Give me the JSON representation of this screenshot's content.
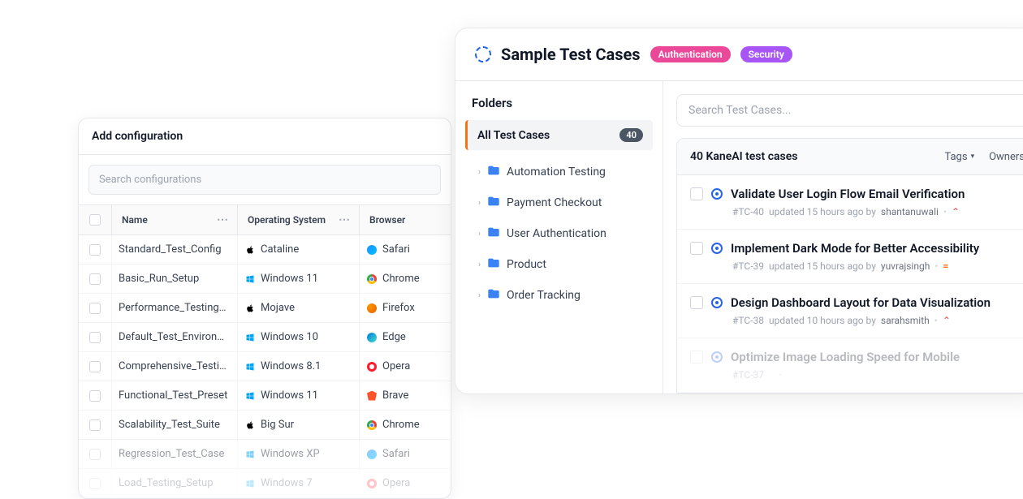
{
  "config": {
    "title": "Add configuration",
    "search_placeholder": "Search configurations",
    "columns": {
      "name": "Name",
      "os": "Operating System",
      "browser": "Browser"
    },
    "rows": [
      {
        "name": "Standard_Test_Config",
        "os": "Cataline",
        "os_icon": "apple",
        "browser": "Safari",
        "browser_icon": "safari"
      },
      {
        "name": "Basic_Run_Setup",
        "os": "Windows 11",
        "os_icon": "windows",
        "browser": "Chrome",
        "browser_icon": "chrome"
      },
      {
        "name": "Performance_Testing_S...",
        "os": "Mojave",
        "os_icon": "apple",
        "browser": "Firefox",
        "browser_icon": "firefox"
      },
      {
        "name": "Default_Test_Environm...",
        "os": "Windows 10",
        "os_icon": "windows",
        "browser": "Edge",
        "browser_icon": "edge"
      },
      {
        "name": "Comprehensive_Testing...",
        "os": "Windows 8.1",
        "os_icon": "windows",
        "browser": "Opera",
        "browser_icon": "opera"
      },
      {
        "name": "Functional_Test_Preset",
        "os": "Windows 11",
        "os_icon": "windows",
        "browser": "Brave",
        "browser_icon": "brave"
      },
      {
        "name": "Scalability_Test_Suite",
        "os": "Big Sur",
        "os_icon": "apple",
        "browser": "Chrome",
        "browser_icon": "chrome"
      },
      {
        "name": "Regression_Test_Case",
        "os": "Windows XP",
        "os_icon": "windows",
        "browser": "Safari",
        "browser_icon": "safari"
      },
      {
        "name": "Load_Testing_Setup",
        "os": "Windows 7",
        "os_icon": "windows",
        "browser": "Opera",
        "browser_icon": "opera"
      }
    ]
  },
  "testcases": {
    "title": "Sample Test Cases",
    "tags": [
      "Authentication",
      "Security"
    ],
    "sidebar": {
      "title": "Folders",
      "all_label": "All Test Cases",
      "all_count": "40",
      "folders": [
        "Automation Testing",
        "Payment Checkout",
        "User Authentication",
        "Product",
        "Order Tracking"
      ]
    },
    "search_placeholder": "Search Test Cases...",
    "list_title": "40 KaneAI test cases",
    "filters": [
      "Tags",
      "Owners"
    ],
    "items": [
      {
        "title": "Validate User Login Flow  Email Verification",
        "id": "#TC-40",
        "updated": "updated 15 hours ago by",
        "author": "shantanuwali",
        "priority": "up"
      },
      {
        "title": "Implement Dark Mode for Better Accessibility",
        "id": "#TC-39",
        "updated": "updated 15 hours ago by",
        "author": "yuvrajsingh",
        "priority": "eq"
      },
      {
        "title": "Design Dashboard Layout for Data Visualization",
        "id": "#TC-38",
        "updated": "updated 10 hours ago by",
        "author": "sarahsmith",
        "priority": "up"
      },
      {
        "title": "Optimize Image Loading Speed for Mobile",
        "id": "#TC-37",
        "updated": "",
        "author": "",
        "priority": ""
      }
    ]
  }
}
